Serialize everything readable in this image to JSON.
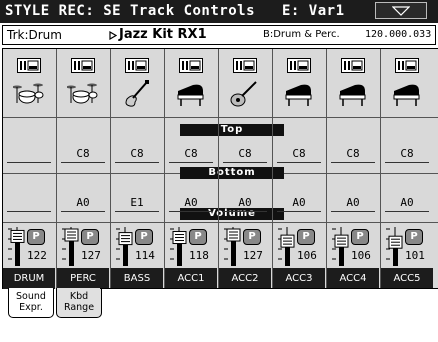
{
  "title": {
    "text": "STYLE REC: SE Track Controls",
    "variation": "E: Var1",
    "menu_icon": "triangle-down-icon"
  },
  "info": {
    "track": "Trk:Drum",
    "kit": "Jazz Kit RX1",
    "category": "B:Drum & Perc.",
    "program": "120.000.033"
  },
  "sections": {
    "top": "Top",
    "bottom": "Bottom",
    "volume": "Volume"
  },
  "tracks": [
    {
      "name": "DRUM",
      "icon": "drum-kit-icon",
      "top": "",
      "bottom": "",
      "volume": "122",
      "volume_level": 0.96
    },
    {
      "name": "PERC",
      "icon": "drum-kit-icon",
      "top": "C8",
      "bottom": "A0",
      "volume": "127",
      "volume_level": 1.0
    },
    {
      "name": "BASS",
      "icon": "bass-guitar-icon",
      "top": "C8",
      "bottom": "E1",
      "volume": "114",
      "volume_level": 0.9
    },
    {
      "name": "ACC1",
      "icon": "piano-icon",
      "top": "C8",
      "bottom": "A0",
      "volume": "118",
      "volume_level": 0.93
    },
    {
      "name": "ACC2",
      "icon": "acoustic-guitar-icon",
      "top": "C8",
      "bottom": "A0",
      "volume": "127",
      "volume_level": 1.0
    },
    {
      "name": "ACC3",
      "icon": "piano-icon",
      "top": "C8",
      "bottom": "A0",
      "volume": "106",
      "volume_level": 0.83
    },
    {
      "name": "ACC4",
      "icon": "piano-icon",
      "top": "C8",
      "bottom": "A0",
      "volume": "106",
      "volume_level": 0.83
    },
    {
      "name": "ACC5",
      "icon": "piano-icon",
      "top": "C8",
      "bottom": "A0",
      "volume": "101",
      "volume_level": 0.8
    }
  ],
  "mute_icon": "play-mute-icon",
  "play_badge": "P",
  "tabs": [
    {
      "label_line1": "Sound",
      "label_line2": "Expr.",
      "active": true
    },
    {
      "label_line1": "Kbd",
      "label_line2": "Range",
      "active": false
    }
  ]
}
